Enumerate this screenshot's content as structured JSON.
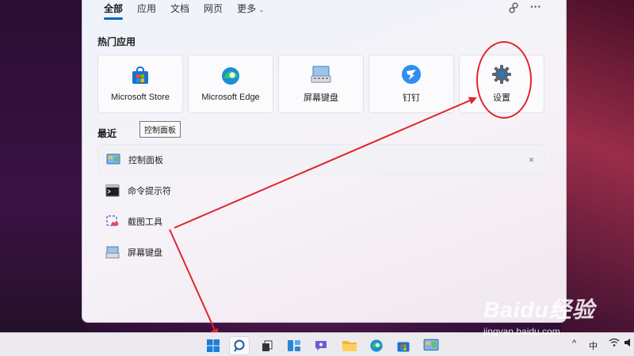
{
  "search_panel": {
    "tabs": [
      {
        "label": "全部"
      },
      {
        "label": "应用"
      },
      {
        "label": "文档"
      },
      {
        "label": "网页"
      },
      {
        "label": "更多"
      }
    ],
    "more_icon": "ellipsis-icon",
    "account_icon": "people-icon",
    "top_apps_title": "热门应用",
    "top_apps": [
      {
        "label": "Microsoft Store",
        "icon": "microsoft-store-icon"
      },
      {
        "label": "Microsoft Edge",
        "icon": "edge-icon"
      },
      {
        "label": "屏幕键盘",
        "icon": "on-screen-keyboard-icon"
      },
      {
        "label": "钉钉",
        "icon": "dingtalk-icon"
      },
      {
        "label": "设置",
        "icon": "settings-gear-icon"
      }
    ],
    "recent_title": "最近",
    "tooltip": "控制面板",
    "recent_items": [
      {
        "label": "控制面板",
        "icon": "control-panel-icon"
      },
      {
        "label": "命令提示符",
        "icon": "command-prompt-icon"
      },
      {
        "label": "截图工具",
        "icon": "snipping-tool-icon"
      },
      {
        "label": "屏幕键盘",
        "icon": "on-screen-keyboard-icon"
      }
    ],
    "remove_label": "×"
  },
  "taskbar": {
    "icons": [
      "windows-start-icon",
      "search-icon",
      "task-view-icon",
      "widgets-icon",
      "teams-chat-icon",
      "file-explorer-icon",
      "edge-icon",
      "microsoft-store-icon",
      "control-panel-icon"
    ],
    "tray": {
      "chevron": "^",
      "ime": "中"
    }
  },
  "colors": {
    "accent": "#0067c0",
    "annotation": "#e0252f"
  },
  "watermark": {
    "logo": "Baidu经验",
    "url": "jingyan.baidu.com"
  }
}
